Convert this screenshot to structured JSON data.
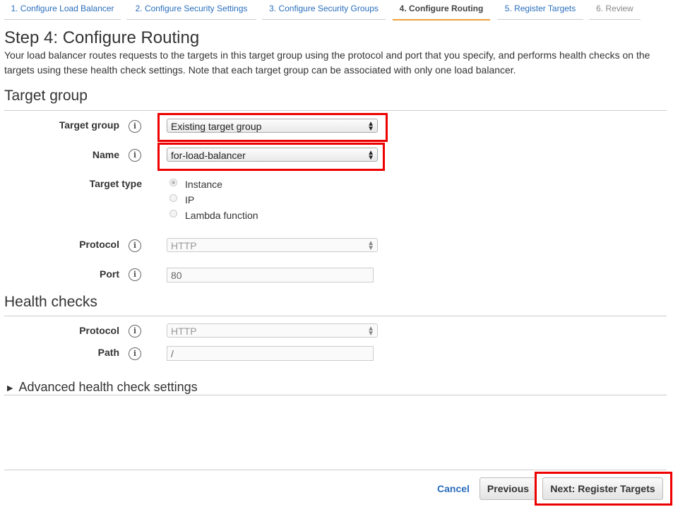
{
  "tabs": [
    {
      "label": "1. Configure Load Balancer"
    },
    {
      "label": "2. Configure Security Settings"
    },
    {
      "label": "3. Configure Security Groups"
    },
    {
      "label": "4. Configure Routing"
    },
    {
      "label": "5. Register Targets"
    },
    {
      "label": "6. Review"
    }
  ],
  "page": {
    "title": "Step 4: Configure Routing",
    "description": "Your load balancer routes requests to the targets in this target group using the protocol and port that you specify, and performs health checks on the targets using these health check settings. Note that each target group can be associated with only one load balancer."
  },
  "target_group": {
    "heading": "Target group",
    "target_group_label": "Target group",
    "target_group_value": "Existing target group",
    "name_label": "Name",
    "name_value": "for-load-balancer",
    "target_type_label": "Target type",
    "target_type_options": [
      "Instance",
      "IP",
      "Lambda function"
    ],
    "protocol_label": "Protocol",
    "protocol_value": "HTTP",
    "port_label": "Port",
    "port_value": "80"
  },
  "health_checks": {
    "heading": "Health checks",
    "protocol_label": "Protocol",
    "protocol_value": "HTTP",
    "path_label": "Path",
    "path_value": "/",
    "advanced_label": "Advanced health check settings"
  },
  "footer": {
    "cancel_label": "Cancel",
    "previous_label": "Previous",
    "next_label": "Next: Register Targets"
  },
  "colors": {
    "link": "#2a6ebb",
    "active_tab_underline": "#f0a03c",
    "highlight": "#e00000"
  },
  "icons": {
    "info": "i",
    "dropdown_arrows": "updown-arrows",
    "expand": "triangle-right"
  }
}
